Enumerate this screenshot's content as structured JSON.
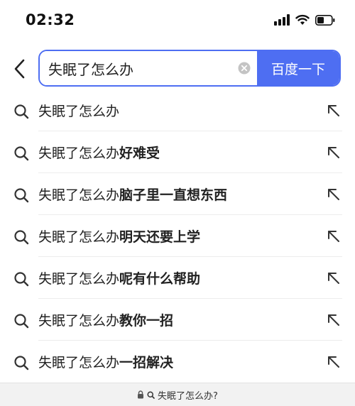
{
  "status_bar": {
    "time": "02:32",
    "icons": [
      "signal-icon",
      "wifi-icon",
      "battery-icon"
    ]
  },
  "search": {
    "query": "失眠了怎么办",
    "submit_label": "百度一下",
    "accent_color": "#4e6ef2"
  },
  "suggestions": [
    {
      "prefix": "失眠了怎么办",
      "suffix": ""
    },
    {
      "prefix": "失眠了怎么办",
      "suffix": "好难受"
    },
    {
      "prefix": "失眠了怎么办",
      "suffix": "脑子里一直想东西"
    },
    {
      "prefix": "失眠了怎么办",
      "suffix": "明天还要上学"
    },
    {
      "prefix": "失眠了怎么办",
      "suffix": "呢有什么帮助"
    },
    {
      "prefix": "失眠了怎么办",
      "suffix": "教你一招"
    },
    {
      "prefix": "失眠了怎么办",
      "suffix": "一招解决"
    }
  ],
  "bottom_bar": {
    "url_text": "失眠了怎么办?"
  }
}
